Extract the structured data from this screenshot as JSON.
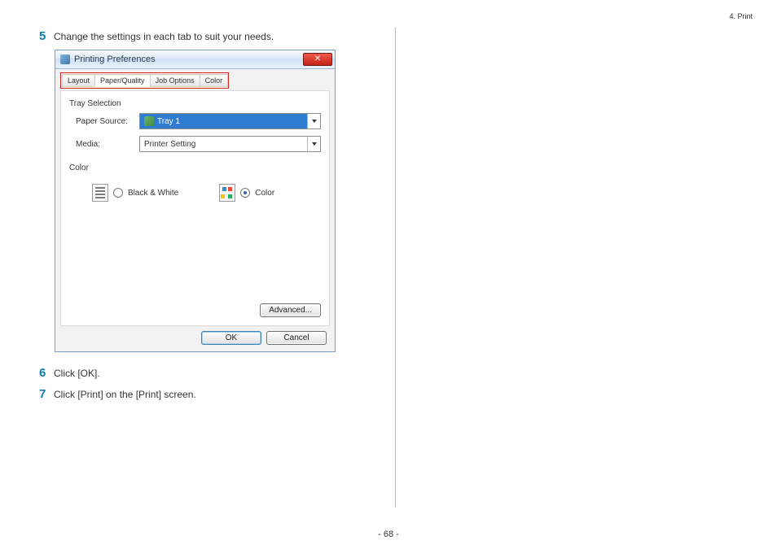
{
  "header": {
    "section": "4. Print"
  },
  "footer": {
    "page": "- 68 -"
  },
  "steps": {
    "s5": {
      "num": "5",
      "text": "Change the settings in each tab to suit your needs."
    },
    "s6": {
      "num": "6",
      "text": "Click [OK]."
    },
    "s7": {
      "num": "7",
      "text": "Click [Print] on the [Print] screen."
    }
  },
  "dialog": {
    "title": "Printing Preferences",
    "close_glyph": "✕",
    "tabs": {
      "layout": "Layout",
      "paper_quality": "Paper/Quality",
      "job_options": "Job Options",
      "color": "Color"
    },
    "tray_group": "Tray Selection",
    "paper_source_label": "Paper Source:",
    "paper_source_value": "Tray 1",
    "media_label": "Media:",
    "media_value": "Printer Setting",
    "color_group": "Color",
    "bw_label": "Black & White",
    "color_label": "Color",
    "advanced_btn": "Advanced...",
    "ok_btn": "OK",
    "cancel_btn": "Cancel"
  }
}
